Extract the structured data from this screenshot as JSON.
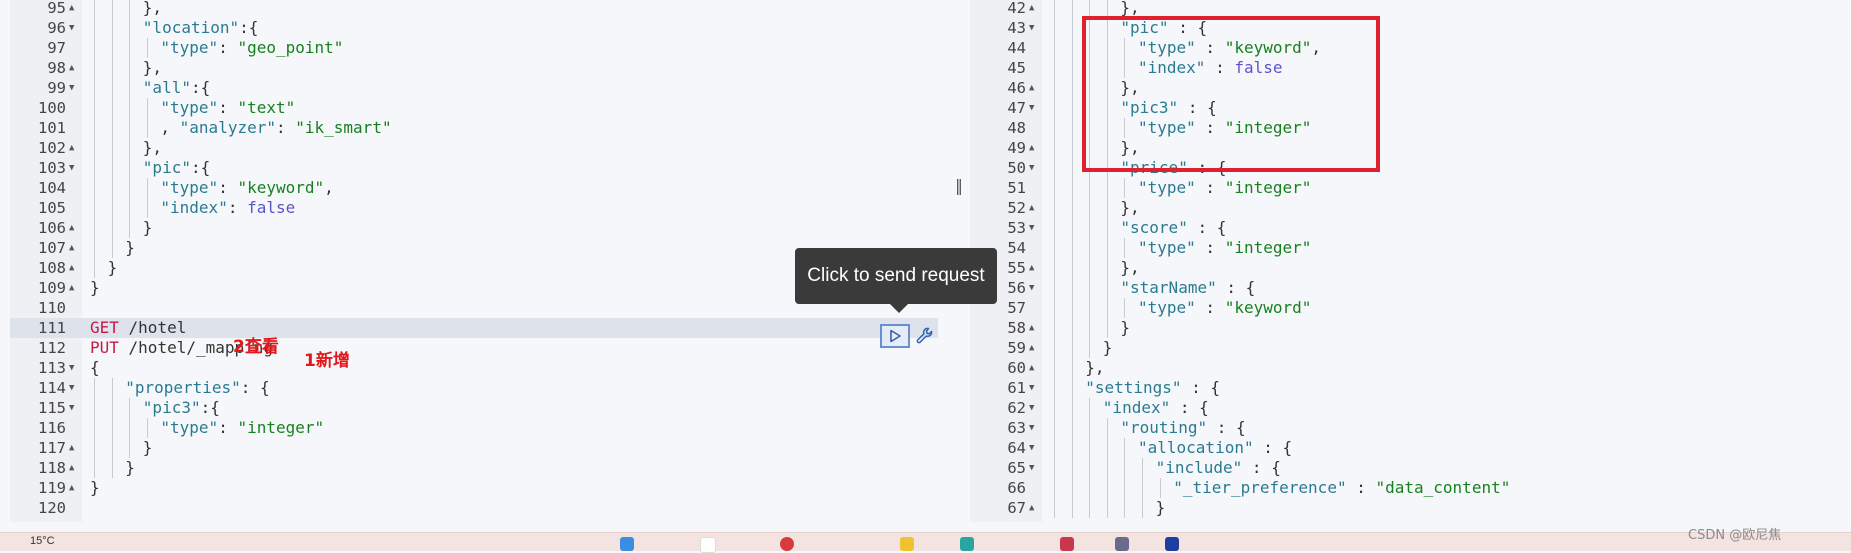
{
  "left_editor": {
    "lines": [
      {
        "n": "95",
        "fold": "up",
        "html": "<span class=\"p\">},</span>",
        "indent": 3
      },
      {
        "n": "96",
        "fold": "down",
        "html": "<span class=\"k\">\"location\"</span><span class=\"p\">:{</span>",
        "indent": 3
      },
      {
        "n": "97",
        "fold": "",
        "html": "<span class=\"k\">\"type\"</span><span class=\"p\">: </span><span class=\"s\">\"geo_point\"</span>",
        "indent": 4
      },
      {
        "n": "98",
        "fold": "up",
        "html": "<span class=\"p\">},</span>",
        "indent": 3
      },
      {
        "n": "99",
        "fold": "down",
        "html": "<span class=\"k\">\"all\"</span><span class=\"p\">:{</span>",
        "indent": 3
      },
      {
        "n": "100",
        "fold": "",
        "html": "<span class=\"k\">\"type\"</span><span class=\"p\">: </span><span class=\"s\">\"text\"</span>",
        "indent": 4
      },
      {
        "n": "101",
        "fold": "",
        "html": "<span class=\"p\">, </span><span class=\"k\">\"analyzer\"</span><span class=\"p\">: </span><span class=\"s\">\"ik_smart\"</span>",
        "indent": 4
      },
      {
        "n": "102",
        "fold": "up",
        "html": "<span class=\"p\">},</span>",
        "indent": 3
      },
      {
        "n": "103",
        "fold": "down",
        "html": "<span class=\"k\">\"pic\"</span><span class=\"p\">:{</span>",
        "indent": 3
      },
      {
        "n": "104",
        "fold": "",
        "html": "<span class=\"k\">\"type\"</span><span class=\"p\">: </span><span class=\"s\">\"keyword\"</span><span class=\"p\">,</span>",
        "indent": 4
      },
      {
        "n": "105",
        "fold": "",
        "html": "<span class=\"k\">\"index\"</span><span class=\"p\">: </span><span class=\"b\">false</span>",
        "indent": 4
      },
      {
        "n": "106",
        "fold": "up",
        "html": "<span class=\"p\">}</span>",
        "indent": 3
      },
      {
        "n": "107",
        "fold": "up",
        "html": "<span class=\"p\">}</span>",
        "indent": 2
      },
      {
        "n": "108",
        "fold": "up",
        "html": "<span class=\"p\">}</span>",
        "indent": 1
      },
      {
        "n": "109",
        "fold": "up",
        "html": "<span class=\"p\">}</span>",
        "indent": 0
      },
      {
        "n": "110",
        "fold": "",
        "html": "",
        "indent": 0
      },
      {
        "n": "111",
        "fold": "",
        "html": "<span class=\"m\">GET</span><span class=\"p\"> /hotel</span>",
        "indent": 0,
        "highlight": true
      },
      {
        "n": "112",
        "fold": "",
        "html": "<span class=\"m\">PUT</span><span class=\"p\"> /hotel/_mapping</span>",
        "indent": 0
      },
      {
        "n": "113",
        "fold": "down",
        "html": "<span class=\"p\">{</span>",
        "indent": 0
      },
      {
        "n": "114",
        "fold": "down",
        "html": "<span class=\"k\">\"properties\"</span><span class=\"p\">: {</span>",
        "indent": 2
      },
      {
        "n": "115",
        "fold": "down",
        "html": "<span class=\"k\">\"pic3\"</span><span class=\"p\">:{</span>",
        "indent": 3
      },
      {
        "n": "116",
        "fold": "",
        "html": "<span class=\"k\">\"type\"</span><span class=\"p\">: </span><span class=\"s\">\"integer\"</span>",
        "indent": 4
      },
      {
        "n": "117",
        "fold": "up",
        "html": "<span class=\"p\">}</span>",
        "indent": 3
      },
      {
        "n": "118",
        "fold": "up",
        "html": "<span class=\"p\">}</span>",
        "indent": 2
      },
      {
        "n": "119",
        "fold": "up",
        "html": "<span class=\"p\">}</span>",
        "indent": 0
      },
      {
        "n": "120",
        "fold": "",
        "html": "",
        "indent": 0
      }
    ]
  },
  "right_editor": {
    "lines": [
      {
        "n": "42",
        "fold": "up",
        "html": "<span class=\"p\">},</span>",
        "indent": 4
      },
      {
        "n": "43",
        "fold": "down",
        "html": "<span class=\"k\">\"pic\"</span><span class=\"p\"> : {</span>",
        "indent": 4
      },
      {
        "n": "44",
        "fold": "",
        "html": "<span class=\"k\">\"type\"</span><span class=\"p\"> : </span><span class=\"s\">\"keyword\"</span><span class=\"p\">,</span>",
        "indent": 5
      },
      {
        "n": "45",
        "fold": "",
        "html": "<span class=\"k\">\"index\"</span><span class=\"p\"> : </span><span class=\"b\">false</span>",
        "indent": 5
      },
      {
        "n": "46",
        "fold": "up",
        "html": "<span class=\"p\">},</span>",
        "indent": 4
      },
      {
        "n": "47",
        "fold": "down",
        "html": "<span class=\"k\">\"pic3\"</span><span class=\"p\"> : {</span>",
        "indent": 4
      },
      {
        "n": "48",
        "fold": "",
        "html": "<span class=\"k\">\"type\"</span><span class=\"p\"> : </span><span class=\"s\">\"integer\"</span>",
        "indent": 5
      },
      {
        "n": "49",
        "fold": "up",
        "html": "<span class=\"p\">},</span>",
        "indent": 4
      },
      {
        "n": "50",
        "fold": "down",
        "html": "<span class=\"k\">\"price\"</span><span class=\"p\"> : {</span>",
        "indent": 4
      },
      {
        "n": "51",
        "fold": "",
        "html": "<span class=\"k\">\"type\"</span><span class=\"p\"> : </span><span class=\"s\">\"integer\"</span>",
        "indent": 5
      },
      {
        "n": "52",
        "fold": "up",
        "html": "<span class=\"p\">},</span>",
        "indent": 4
      },
      {
        "n": "53",
        "fold": "down",
        "html": "<span class=\"k\">\"score\"</span><span class=\"p\"> : {</span>",
        "indent": 4
      },
      {
        "n": "54",
        "fold": "",
        "html": "<span class=\"k\">\"type\"</span><span class=\"p\"> : </span><span class=\"s\">\"integer\"</span>",
        "indent": 5
      },
      {
        "n": "55",
        "fold": "up",
        "html": "<span class=\"p\">},</span>",
        "indent": 4
      },
      {
        "n": "56",
        "fold": "down",
        "html": "<span class=\"k\">\"starName\"</span><span class=\"p\"> : {</span>",
        "indent": 4
      },
      {
        "n": "57",
        "fold": "",
        "html": "<span class=\"k\">\"type\"</span><span class=\"p\"> : </span><span class=\"s\">\"keyword\"</span>",
        "indent": 5
      },
      {
        "n": "58",
        "fold": "up",
        "html": "<span class=\"p\">}</span>",
        "indent": 4
      },
      {
        "n": "59",
        "fold": "up",
        "html": "<span class=\"p\">}</span>",
        "indent": 3
      },
      {
        "n": "60",
        "fold": "up",
        "html": "<span class=\"p\">},</span>",
        "indent": 2
      },
      {
        "n": "61",
        "fold": "down",
        "html": "<span class=\"k\">\"settings\"</span><span class=\"p\"> : {</span>",
        "indent": 2
      },
      {
        "n": "62",
        "fold": "down",
        "html": "<span class=\"k\">\"index\"</span><span class=\"p\"> : {</span>",
        "indent": 3
      },
      {
        "n": "63",
        "fold": "down",
        "html": "<span class=\"k\">\"routing\"</span><span class=\"p\"> : {</span>",
        "indent": 4
      },
      {
        "n": "64",
        "fold": "down",
        "html": "<span class=\"k\">\"allocation\"</span><span class=\"p\"> : {</span>",
        "indent": 5
      },
      {
        "n": "65",
        "fold": "down",
        "html": "<span class=\"k\">\"include\"</span><span class=\"p\"> : {</span>",
        "indent": 6
      },
      {
        "n": "66",
        "fold": "",
        "html": "<span class=\"k\">\"_tier_preference\"</span><span class=\"p\"> : </span><span class=\"s\">\"data_content\"</span>",
        "indent": 7
      },
      {
        "n": "67",
        "fold": "up",
        "html": "<span class=\"p\">}</span>",
        "indent": 6
      }
    ]
  },
  "tooltip": {
    "text": "Click to send request"
  },
  "annotations": {
    "view": "2查看",
    "add": "1新增"
  },
  "taskbar": {
    "temp": "15°C"
  },
  "watermark": "CSDN @欧尼焦"
}
